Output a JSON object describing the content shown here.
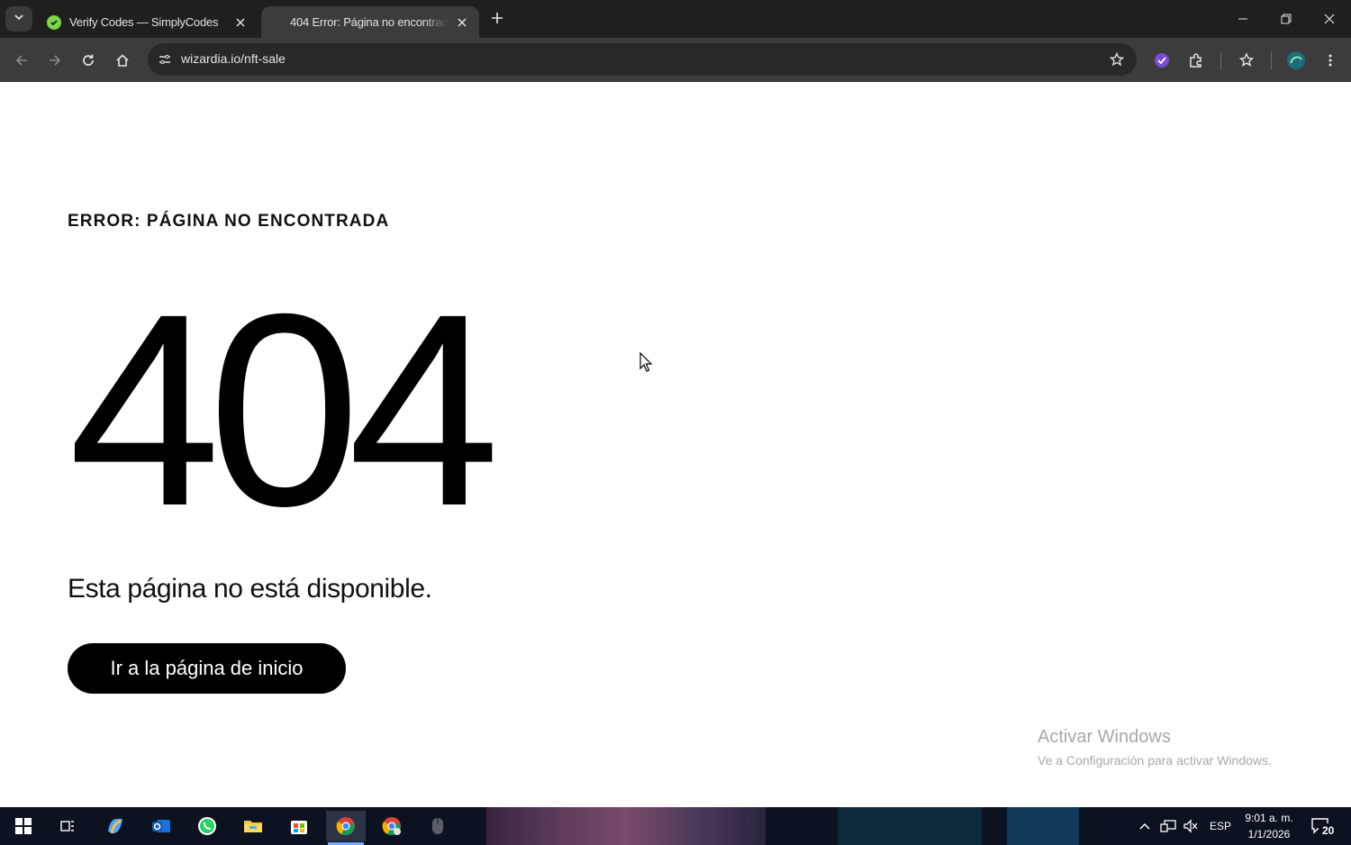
{
  "browser": {
    "tabs": [
      {
        "title": "Verify Codes — SimplyCodes",
        "active": false
      },
      {
        "title": "404 Error: Página no encontrada",
        "active": true
      }
    ],
    "url": "wizardia.io/nft-sale"
  },
  "page": {
    "heading": "ERROR: PÁGINA NO ENCONTRADA",
    "code": "404",
    "message": "Esta página no está disponible.",
    "home_button": "Ir a la página de inicio"
  },
  "watermark": {
    "title": "Activar Windows",
    "subtitle": "Ve a Configuración para activar Windows."
  },
  "taskbar": {
    "language": "ESP",
    "time": "9:01 a. m.",
    "date": "1/1/2026",
    "notifications": "20",
    "apps": [
      "start-icon",
      "task-view-icon",
      "copilot-icon",
      "outlook-icon",
      "whatsapp-icon",
      "file-explorer-icon",
      "store-icon",
      "chrome-icon",
      "chrome-profile-icon",
      "mouse-app-icon"
    ]
  },
  "colors": {
    "tabstrip": "#1f1f1f",
    "toolbar": "#3c3c3c",
    "button": "#000000",
    "taskbar": "#0c1220"
  }
}
